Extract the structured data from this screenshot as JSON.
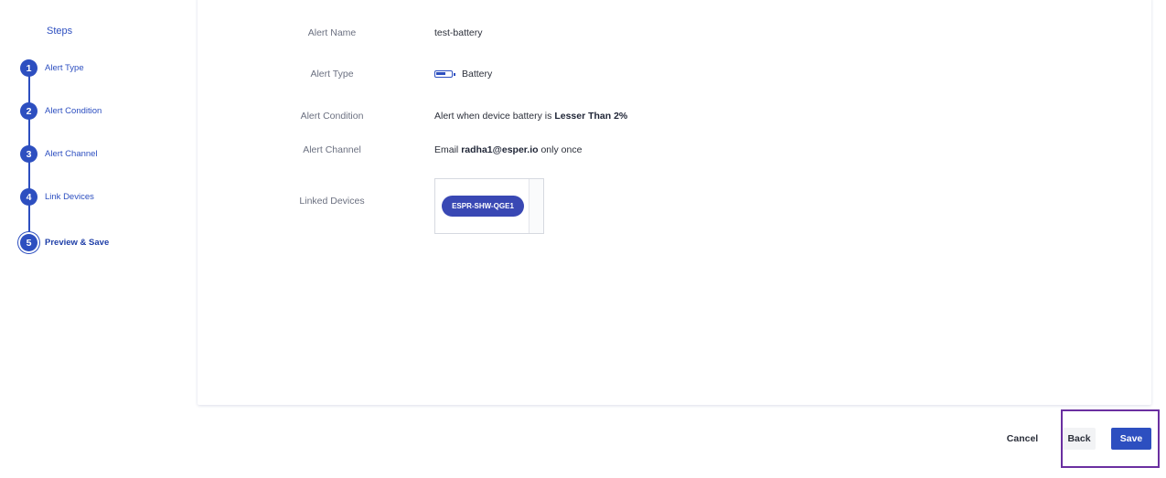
{
  "sidebar": {
    "title": "Steps",
    "steps": [
      {
        "number": "1",
        "label": "Alert Type"
      },
      {
        "number": "2",
        "label": "Alert Condition"
      },
      {
        "number": "3",
        "label": "Alert Channel"
      },
      {
        "number": "4",
        "label": "Link Devices"
      },
      {
        "number": "5",
        "label": "Preview & Save",
        "active": true
      }
    ]
  },
  "preview": {
    "alert_name": {
      "label": "Alert Name",
      "value": "test-battery"
    },
    "alert_type": {
      "label": "Alert Type",
      "value": "Battery",
      "icon": "battery-icon"
    },
    "alert_condition": {
      "label": "Alert Condition",
      "prefix": "Alert when device battery is ",
      "value": "Lesser Than 2%"
    },
    "alert_channel": {
      "label": "Alert Channel",
      "prefix": "Email ",
      "email": "radha1@esper.io",
      "suffix": " only once"
    },
    "linked_devices": {
      "label": "Linked Devices",
      "devices": [
        "ESPR-SHW-QGE1"
      ]
    }
  },
  "footer": {
    "cancel_label": "Cancel",
    "back_label": "Back",
    "save_label": "Save"
  },
  "colors": {
    "accent": "#2d4fc0",
    "chip": "#3948b4",
    "highlight": "#6a2fa0"
  }
}
